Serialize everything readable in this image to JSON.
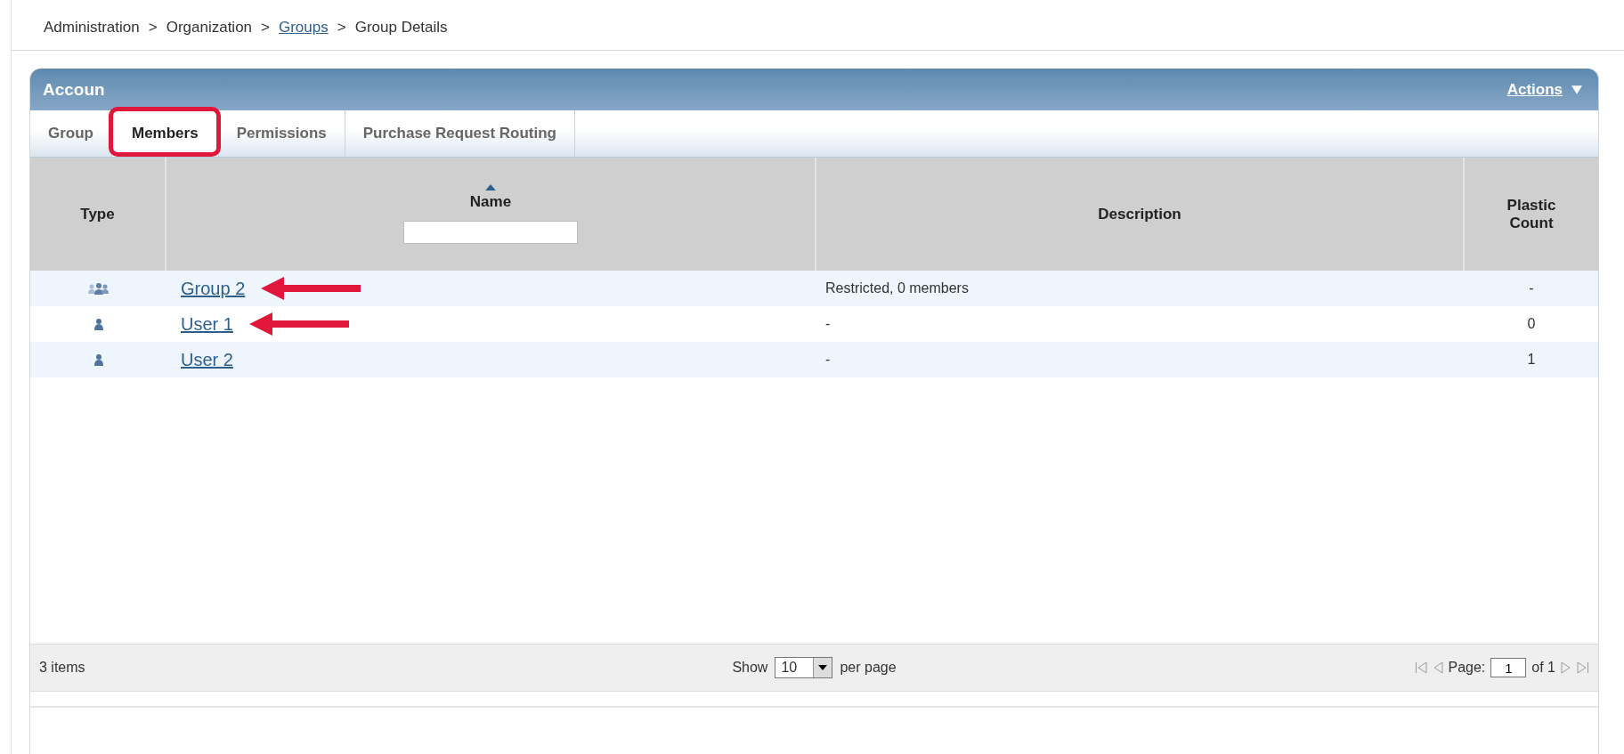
{
  "breadcrumb": [
    {
      "label": "Administration",
      "link": false
    },
    {
      "separator": ">",
      "label": "Organization",
      "link": false
    },
    {
      "separator": ">",
      "label": "Groups",
      "link": true
    },
    {
      "separator": ">",
      "label": "Group Details",
      "link": false
    }
  ],
  "panel": {
    "title": "Accoun",
    "actions": "Actions"
  },
  "tabs": [
    {
      "label": "Group",
      "selected": false,
      "highlighted": false
    },
    {
      "label": "Members",
      "selected": true,
      "highlighted": true
    },
    {
      "label": "Permissions",
      "selected": false,
      "highlighted": false
    },
    {
      "label": "Purchase Request Routing",
      "selected": false,
      "highlighted": false
    }
  ],
  "table": {
    "columns": [
      {
        "label": "Type",
        "sorted": false,
        "filter": false
      },
      {
        "label": "Name",
        "sorted": true,
        "filter": true
      },
      {
        "label": "Description",
        "sorted": false,
        "filter": false
      },
      {
        "label": "Plastic Count",
        "sorted": false,
        "filter": false
      }
    ],
    "rows": [
      {
        "kind": "group",
        "name": "Group 2",
        "description": "Restricted, 0 members",
        "plastic_count": "-",
        "arrow": true
      },
      {
        "kind": "user",
        "name": "User 1",
        "description": "-",
        "plastic_count": "0",
        "arrow": true
      },
      {
        "kind": "user",
        "name": "User 2",
        "description": "-",
        "plastic_count": "1",
        "arrow": false
      }
    ]
  },
  "footer": {
    "count": "3 items",
    "show_label": "Show",
    "page_size": "10",
    "per_page_label": "per page",
    "page_label": "Page:",
    "page": "1",
    "of_label": "of 1"
  }
}
